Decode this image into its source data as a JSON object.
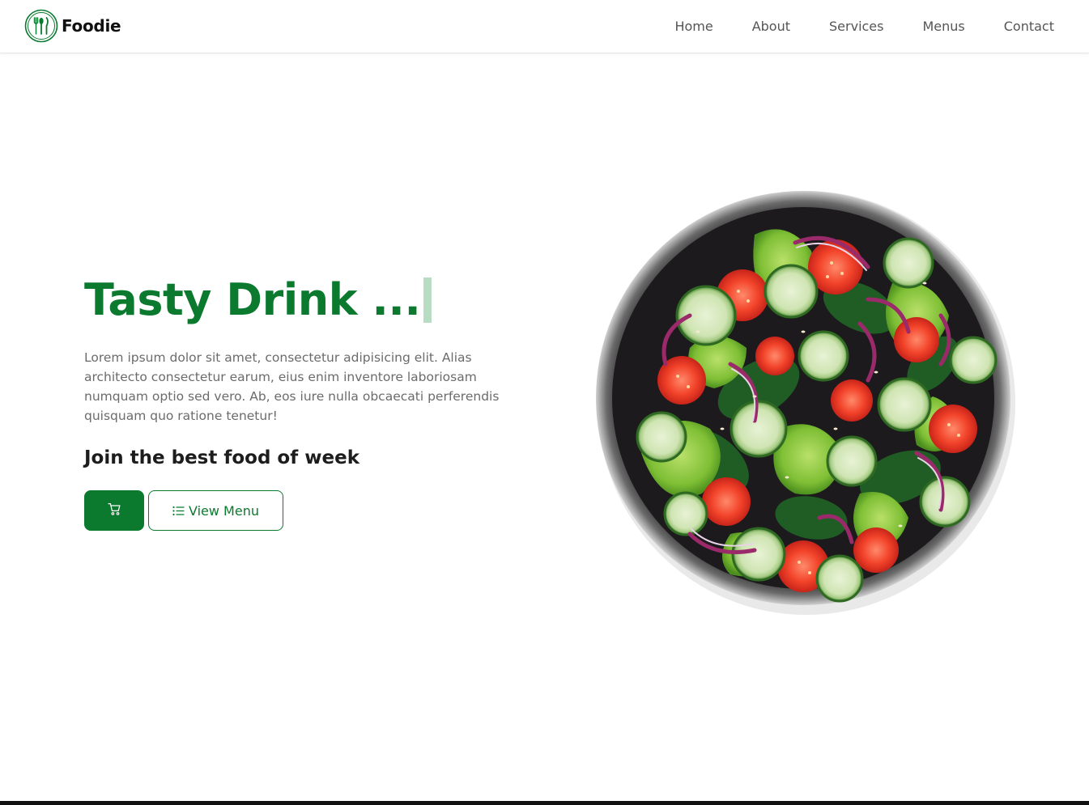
{
  "brand": {
    "name": "Foodie",
    "logo_icon": "fork-spoon-knife-icon",
    "accent_color": "#0b7a2e"
  },
  "nav": {
    "items": [
      {
        "label": "Home"
      },
      {
        "label": "About"
      },
      {
        "label": "Services"
      },
      {
        "label": "Menus"
      },
      {
        "label": "Contact"
      }
    ]
  },
  "hero": {
    "title": "Tasty Drink ...",
    "description": "Lorem ipsum dolor sit amet, consectetur adipisicing elit. Alias architecto consectetur earum, eius enim inventore laboriosam numquam optio sed vero. Ab, eos iure nulla obcaecati perferendis quisquam quo ratione tenetur!",
    "subtitle": "Join the best food of week",
    "cart_button_icon": "cart-icon",
    "menu_button": {
      "icon": "list-icon",
      "label": "View Menu"
    },
    "image": {
      "subject": "salad-bowl-image"
    }
  }
}
